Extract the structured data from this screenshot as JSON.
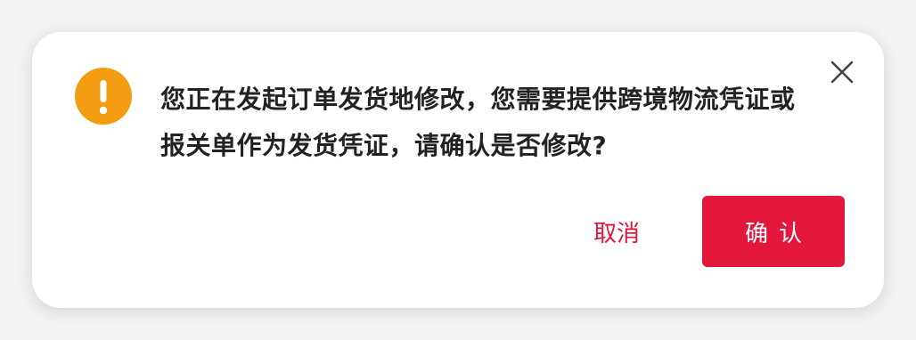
{
  "dialog": {
    "message": "您正在发起订单发货地修改，您需要提供跨境物流凭证或报关单作为发货凭证，请确认是否修改?",
    "cancel_label": "取消",
    "confirm_label": "确认",
    "icons": {
      "warning": "warning-icon",
      "close": "close-icon"
    },
    "colors": {
      "accent": "#e3163c",
      "warning": "#f39c12"
    }
  }
}
